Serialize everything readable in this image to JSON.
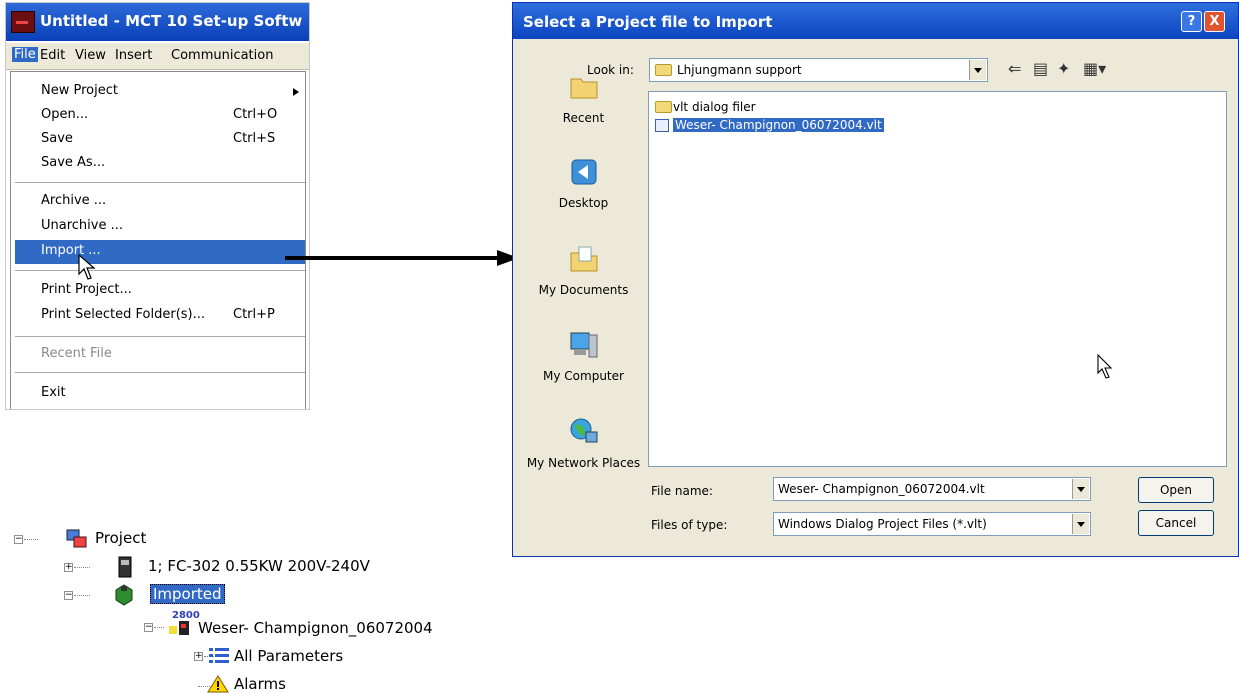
{
  "mct": {
    "title": "Untitled - MCT 10 Set-up Softw",
    "menubar": [
      "File",
      "Edit",
      "View",
      "Insert",
      "Communication"
    ],
    "menu": [
      {
        "label": "New Project",
        "shortcut": "",
        "submenu": true
      },
      {
        "label": "Open...",
        "shortcut": "Ctrl+O"
      },
      {
        "label": "Save",
        "shortcut": "Ctrl+S"
      },
      {
        "label": "Save As..."
      },
      {
        "label": "Archive ..."
      },
      {
        "label": "Unarchive ..."
      },
      {
        "label": "Import ...",
        "highlighted": true
      },
      {
        "label": "Print Project..."
      },
      {
        "label": "Print Selected Folder(s)...",
        "shortcut": "Ctrl+P"
      },
      {
        "label": "Recent File",
        "disabled": true
      },
      {
        "label": "Exit"
      }
    ]
  },
  "dialog": {
    "title": "Select a Project file to Import",
    "help_label": "?",
    "close_label": "X",
    "look_in_label": "Look in:",
    "look_in_value": "Lhjungmann support",
    "places": [
      "Recent",
      "Desktop",
      "My Documents",
      "My Computer",
      "My Network Places"
    ],
    "files": [
      {
        "name": "vlt dialog filer",
        "type": "folder"
      },
      {
        "name": "Weser- Champignon_06072004.vlt",
        "type": "file",
        "selected": true
      }
    ],
    "file_name_label": "File name:",
    "file_name_value": "Weser- Champignon_06072004.vlt",
    "file_type_label": "Files of type:",
    "file_type_value": "Windows Dialog Project Files (*.vlt)",
    "open_label": "Open",
    "cancel_label": "Cancel"
  },
  "tree": {
    "project": "Project",
    "drive": "1; FC-302 0.55KW 200V-240V",
    "imported": "Imported",
    "file": "Weser- Champignon_06072004",
    "file_badge": "2800",
    "params": "All Parameters",
    "alarms": "Alarms"
  },
  "colors": {
    "titlebar": "#0a3fb9",
    "selection": "#316ac5",
    "dialog_face": "#ece9d8"
  }
}
